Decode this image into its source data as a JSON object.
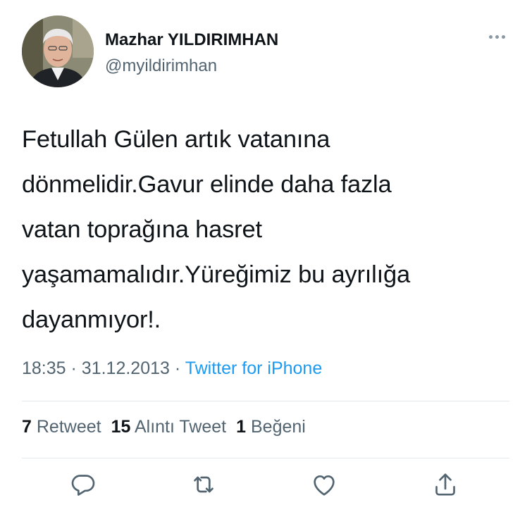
{
  "user": {
    "display_name": "Mazhar YILDIRIMHAN",
    "handle": "@myildirimhan"
  },
  "tweet": {
    "lines": [
      "Fetullah Gülen artık vatanına",
      "dönmelidir.Gavur elinde daha fazla",
      "vatan toprağına hasret",
      "yaşamamalıdır.Yüreğimiz bu ayrılığa",
      "dayanmıyor!."
    ],
    "time": "18:35",
    "date": "31.12.2013",
    "separator": "·",
    "source": "Twitter for iPhone"
  },
  "stats": {
    "retweets_count": "7",
    "retweets_label": "Retweet",
    "quotes_count": "15",
    "quotes_label": "Alıntı Tweet",
    "likes_count": "1",
    "likes_label": "Beğeni"
  },
  "icons": {
    "more": "more-horizontal-icon",
    "reply": "reply-icon",
    "retweet": "retweet-icon",
    "like": "heart-icon",
    "share": "share-icon"
  },
  "colors": {
    "text": "#0f1419",
    "secondary": "#536471",
    "link": "#1d9bf0",
    "icon": "#536471"
  }
}
